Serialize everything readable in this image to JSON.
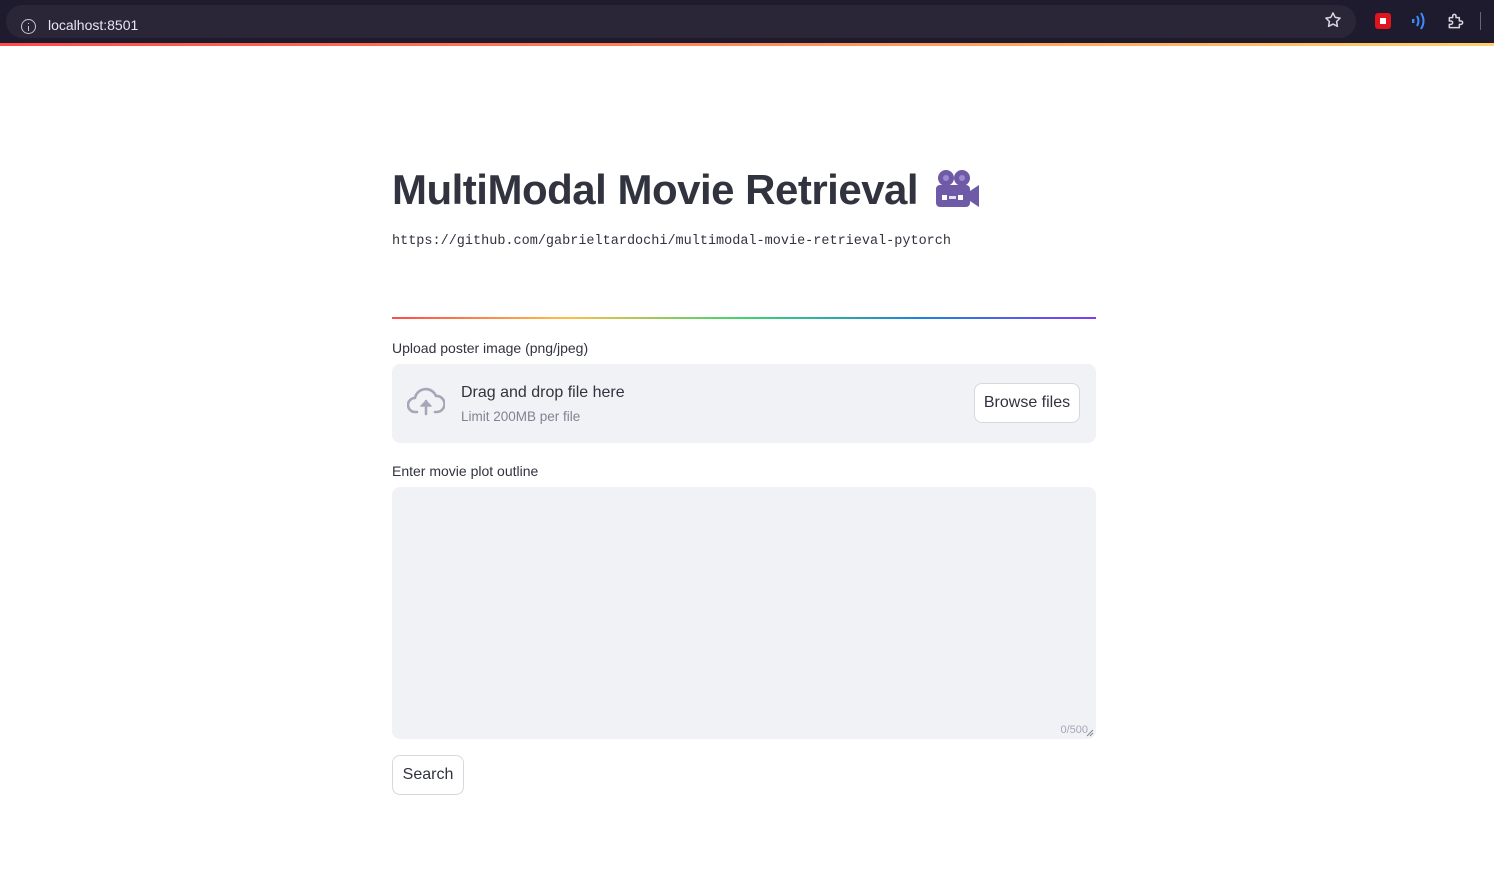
{
  "browser": {
    "url": "localhost:8501"
  },
  "app": {
    "title": "MultiModal Movie Retrieval",
    "title_icon": "movie-camera-icon",
    "repo_url": "https://github.com/gabrieltardochi/multimodal-movie-retrieval-pytorch"
  },
  "upload": {
    "label": "Upload poster image (png/jpeg)",
    "drop_title": "Drag and drop file here",
    "drop_limit": "Limit 200MB per file",
    "browse_label": "Browse files"
  },
  "plot": {
    "label": "Enter movie plot outline",
    "value": "",
    "counter": "0/500"
  },
  "actions": {
    "search_label": "Search"
  },
  "colors": {
    "text": "#31333f",
    "input_bg": "#f0f2f6",
    "browser_bg": "#1f1b2e",
    "accent_red": "#ff4b4b"
  }
}
